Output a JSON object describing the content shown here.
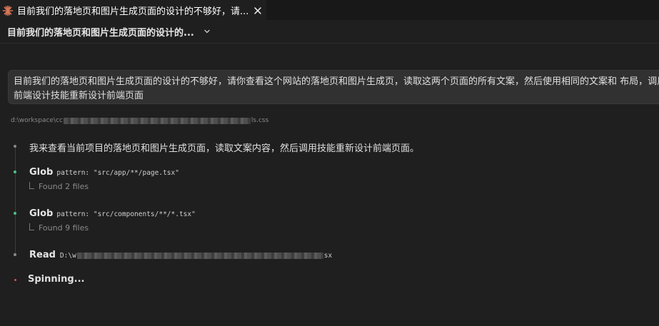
{
  "tab": {
    "title": "目前我们的落地页和图片生成页面的设计的不够好，请...",
    "icon": "claude-sparkle-icon",
    "close_icon": "close-icon"
  },
  "header": {
    "title": "目前我们的落地页和图片生成页面的设计的...",
    "chevron": "chevron-down-icon"
  },
  "user_message": {
    "text": "目前我们的落地页和图片生成页面的设计的不够好，请你查看这个网站的落地页和图片生成页，读取这两个页面的所有文案，然后使用相同的文案和 布局，调用前端设计技能重新设计前端页面"
  },
  "context_file": {
    "prefix": "d:\\workspace\\cc",
    "suffix": "ls.css"
  },
  "assistant": {
    "text": "我来查看当前项目的落地页和图片生成页面，读取文案内容，然后调用技能重新设计前端页面。"
  },
  "tools": [
    {
      "name": "Glob",
      "param": "pattern: \"src/app/**/page.tsx\"",
      "result": "Found 2 files"
    },
    {
      "name": "Glob",
      "param": "pattern: \"src/components/**/*.tsx\"",
      "result": "Found 9 files"
    }
  ],
  "read_tool": {
    "name": "Read",
    "path_prefix": "D:\\w",
    "path_suffix": "sx"
  },
  "status": {
    "text": "Spinning..."
  },
  "colors": {
    "accent_sparkle": "#d97757",
    "success_dot": "#4ec28a",
    "active_dot": "#d9534f"
  }
}
